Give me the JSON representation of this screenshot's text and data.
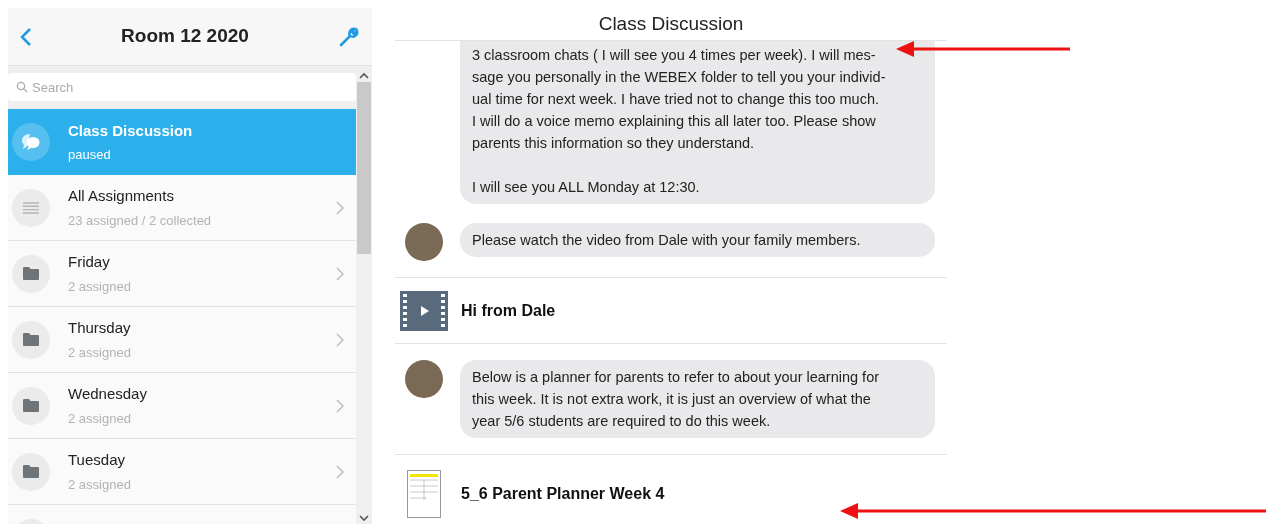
{
  "sidebar": {
    "title": "Room 12 2020",
    "search": {
      "placeholder": "Search"
    },
    "items": [
      {
        "kind": "chat",
        "title": "Class Discussion",
        "subtitle": "paused",
        "selected": true
      },
      {
        "kind": "list",
        "title": "All Assignments",
        "subtitle": "23 assigned / 2 collected",
        "selected": false
      },
      {
        "kind": "folder",
        "title": "Friday",
        "subtitle": "2 assigned",
        "selected": false
      },
      {
        "kind": "folder",
        "title": "Thursday",
        "subtitle": "2 assigned",
        "selected": false
      },
      {
        "kind": "folder",
        "title": "Wednesday",
        "subtitle": "2 assigned",
        "selected": false
      },
      {
        "kind": "folder",
        "title": "Tuesday",
        "subtitle": "2 assigned",
        "selected": false
      }
    ]
  },
  "conversation": {
    "title": "Class Discussion",
    "entries": [
      {
        "kind": "message",
        "avatar": false,
        "paragraphs": [
          "3 classroom chats ( I will see you 4 times per week). I will mes-\nsage you personally in the WEBEX folder to tell you your individ-\nual time for next week. I have tried not to change this too much.\nI will do a voice memo explaining this all later too. Please show\nparents this information so they understand.",
          "I will see you ALL Monday at 12:30."
        ]
      },
      {
        "kind": "message",
        "avatar": true,
        "paragraphs": [
          "Please watch the video from Dale with your family members."
        ]
      },
      {
        "kind": "video",
        "title": "Hi from Dale"
      },
      {
        "kind": "message",
        "avatar": true,
        "paragraphs": [
          "Below is a planner for parents to refer to about your learning for\nthis week. It is not extra work, it is just an overview of what the\nyear 5/6 students are required to do this week."
        ]
      },
      {
        "kind": "document",
        "title": "5_6 Parent Planner Week 4"
      }
    ]
  }
}
